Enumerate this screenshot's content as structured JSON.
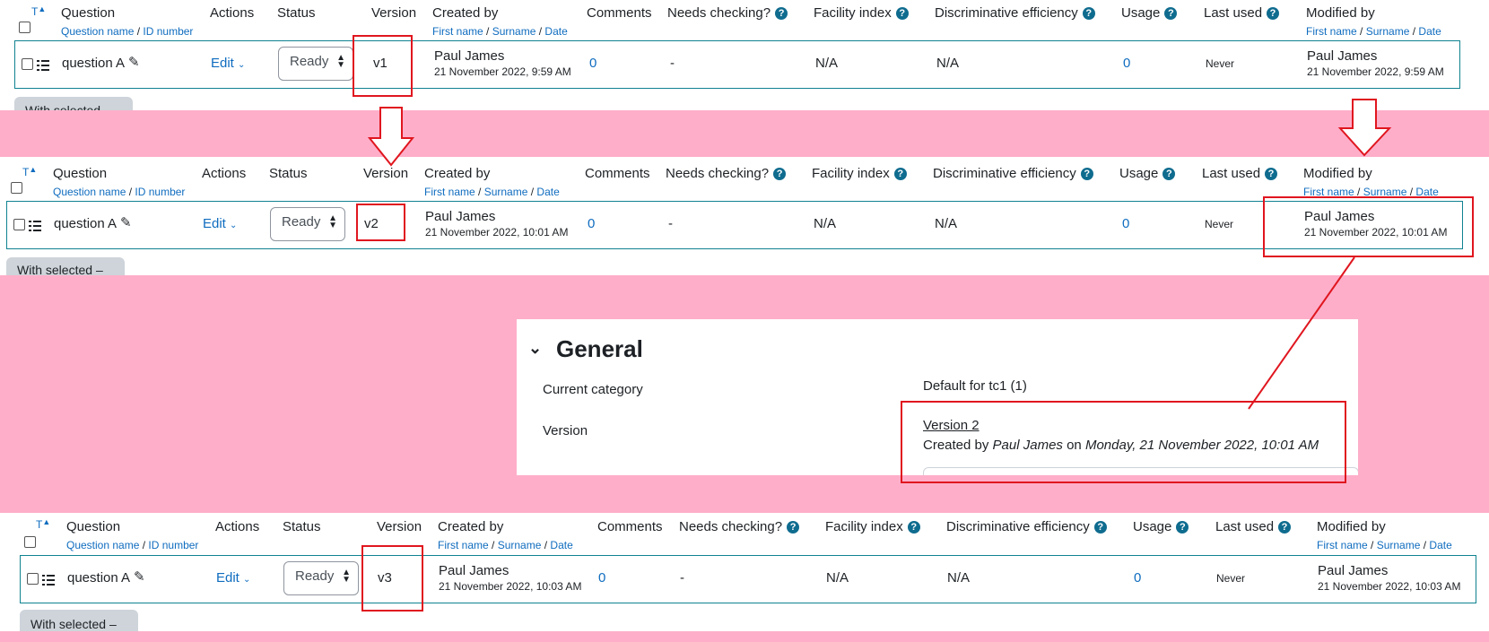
{
  "colors": {
    "highlight": "#e0161f",
    "background_band": "#feaec9",
    "link": "#0f6cbf",
    "row_border": "#0f8290"
  },
  "sort_icon_label": "T",
  "header": {
    "question": "Question",
    "question_sub": [
      "Question name",
      "ID number"
    ],
    "actions": "Actions",
    "status": "Status",
    "version": "Version",
    "created_by": "Created by",
    "person_sub": [
      "First name",
      "Surname",
      "Date"
    ],
    "comments": "Comments",
    "needs_checking": "Needs checking?",
    "facility_index": "Facility index",
    "discriminative_efficiency": "Discriminative efficiency",
    "usage": "Usage",
    "last_used": "Last used",
    "modified_by": "Modified by",
    "help_glyph": "?"
  },
  "rows": [
    {
      "question_name": "question A",
      "action": "Edit",
      "status": "Ready",
      "version": "v1",
      "created_name": "Paul James",
      "created_date": "21 November 2022, 9:59 AM",
      "comments": "0",
      "needs_checking": "-",
      "facility_index": "N/A",
      "discriminative_efficiency": "N/A",
      "usage": "0",
      "last_used": "Never",
      "modified_name": "Paul James",
      "modified_date": "21 November 2022, 9:59 AM"
    },
    {
      "question_name": "question A",
      "action": "Edit",
      "status": "Ready",
      "version": "v2",
      "created_name": "Paul James",
      "created_date": "21 November 2022, 10:01 AM",
      "comments": "0",
      "needs_checking": "-",
      "facility_index": "N/A",
      "discriminative_efficiency": "N/A",
      "usage": "0",
      "last_used": "Never",
      "modified_name": "Paul James",
      "modified_date": "21 November 2022, 10:01 AM"
    },
    {
      "question_name": "question A",
      "action": "Edit",
      "status": "Ready",
      "version": "v3",
      "created_name": "Paul James",
      "created_date": "21 November 2022, 10:03 AM",
      "comments": "0",
      "needs_checking": "-",
      "facility_index": "N/A",
      "discriminative_efficiency": "N/A",
      "usage": "0",
      "last_used": "Never",
      "modified_name": "Paul James",
      "modified_date": "21 November 2022, 10:03 AM"
    }
  ],
  "with_selected": {
    "label": "With selected",
    "caret": "–"
  },
  "general": {
    "title": "General",
    "current_category_label": "Current category",
    "current_category_value": "Default for tc1 (1)",
    "version_label": "Version",
    "version_link": "Version 2",
    "created_prefix": "Created by",
    "created_person": "Paul James",
    "created_on": "on",
    "created_date": "Monday, 21 November 2022, 10:01 AM"
  }
}
